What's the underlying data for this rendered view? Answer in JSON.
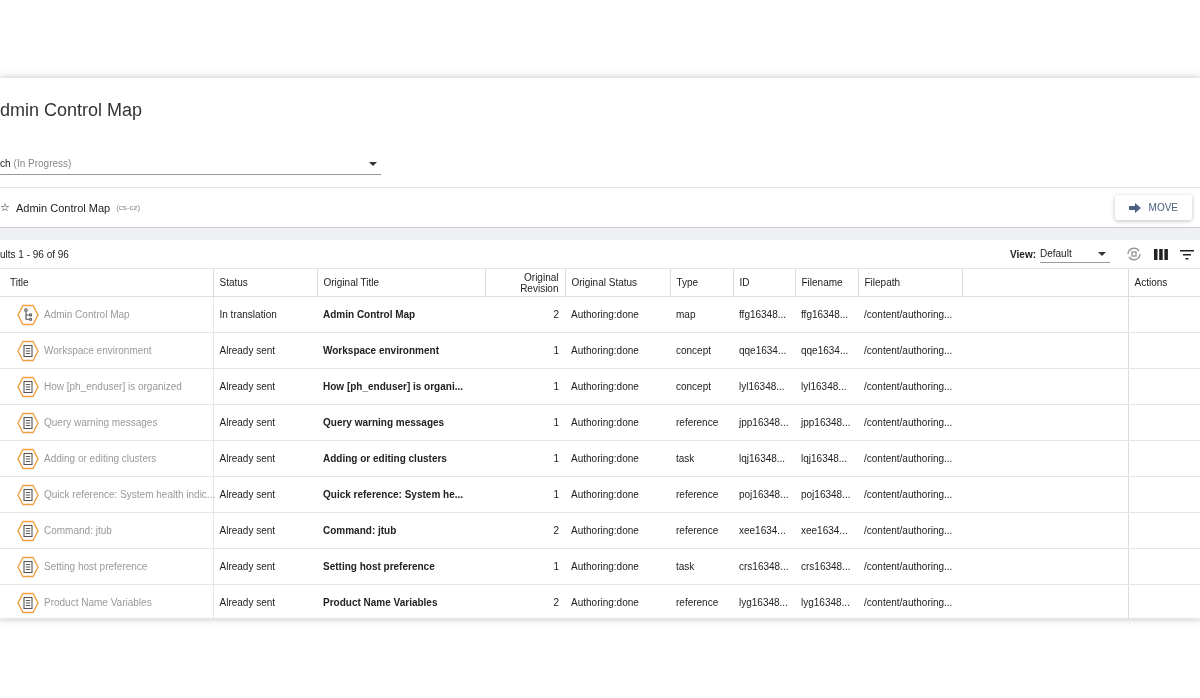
{
  "page": {
    "title": "dmin Control Map"
  },
  "branch_select": {
    "value": "ch",
    "status": "(In Progress)"
  },
  "map_bar": {
    "star": "☆",
    "title": "Admin Control Map",
    "language": "(cs-cz)",
    "move_button": "MOVE"
  },
  "results": {
    "summary": "ults 1 - 96 of 96",
    "view_label": "View:",
    "view_value": "Default"
  },
  "table": {
    "columns": [
      "Title",
      "Status",
      "Original Title",
      "Original Revision",
      "Original Status",
      "Type",
      "ID",
      "Filename",
      "Filepath",
      "Actions"
    ],
    "rows": [
      {
        "kind": "map",
        "title": "Admin Control Map",
        "status": "In translation",
        "original_title": "Admin Control Map",
        "original_revision": "2",
        "original_status": "Authoring:done",
        "type": "map",
        "id": "ffg16348...",
        "filename": "ffg16348...",
        "filepath": "/content/authoring..."
      },
      {
        "kind": "topic",
        "title": "Workspace environment",
        "status": "Already sent",
        "original_title": "Workspace environment",
        "original_revision": "1",
        "original_status": "Authoring:done",
        "type": "concept",
        "id": "qqe1634...",
        "filename": "qqe1634...",
        "filepath": "/content/authoring..."
      },
      {
        "kind": "topic",
        "title": "How [ph_enduser] is organized",
        "status": "Already sent",
        "original_title": "How [ph_enduser] is organi...",
        "original_revision": "1",
        "original_status": "Authoring:done",
        "type": "concept",
        "id": "lyl16348...",
        "filename": "lyl16348...",
        "filepath": "/content/authoring..."
      },
      {
        "kind": "topic",
        "title": "Query warning messages",
        "status": "Already sent",
        "original_title": "Query warning messages",
        "original_revision": "1",
        "original_status": "Authoring:done",
        "type": "reference",
        "id": "jpp16348...",
        "filename": "jpp16348...",
        "filepath": "/content/authoring..."
      },
      {
        "kind": "topic",
        "title": "Adding or editing clusters",
        "status": "Already sent",
        "original_title": "Adding or editing clusters",
        "original_revision": "1",
        "original_status": "Authoring:done",
        "type": "task",
        "id": "lqj16348...",
        "filename": "lqj16348...",
        "filepath": "/content/authoring..."
      },
      {
        "kind": "topic",
        "title": "Quick reference: System health indic...",
        "status": "Already sent",
        "original_title": "Quick reference: System he...",
        "original_revision": "1",
        "original_status": "Authoring:done",
        "type": "reference",
        "id": "poj16348...",
        "filename": "poj16348...",
        "filepath": "/content/authoring..."
      },
      {
        "kind": "topic",
        "title": "Command: jtub",
        "status": "Already sent",
        "original_title": "Command: jtub",
        "original_revision": "2",
        "original_status": "Authoring:done",
        "type": "reference",
        "id": "xee1634...",
        "filename": "xee1634...",
        "filepath": "/content/authoring..."
      },
      {
        "kind": "topic",
        "title": "Setting host preference",
        "status": "Already sent",
        "original_title": "Setting host preference",
        "original_revision": "1",
        "original_status": "Authoring:done",
        "type": "task",
        "id": "crs16348...",
        "filename": "crs16348...",
        "filepath": "/content/authoring..."
      },
      {
        "kind": "topic",
        "title": "Product Name Variables",
        "status": "Already sent",
        "original_title": "Product Name Variables",
        "original_revision": "2",
        "original_status": "Authoring:done",
        "type": "reference",
        "id": "lyg16348...",
        "filename": "lyg16348...",
        "filepath": "/content/authoring..."
      }
    ]
  }
}
